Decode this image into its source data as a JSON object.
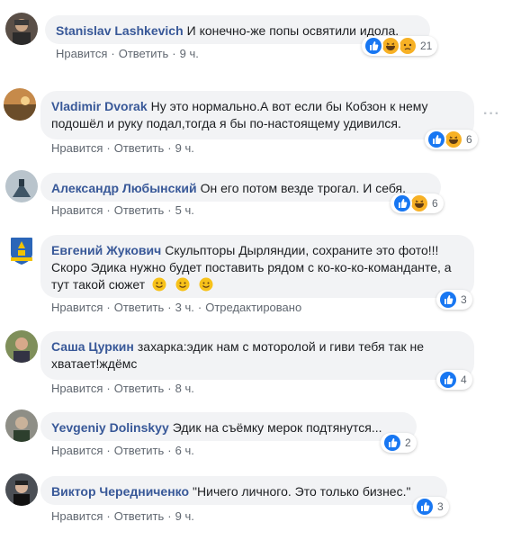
{
  "comments": [
    {
      "author": "Stanislav Lashkevich",
      "text": "И конечно-же попы освятили идола.",
      "like_label": "Нравится",
      "reply_label": "Ответить",
      "time": "9 ч.",
      "reaction_count": "21",
      "reactions": [
        "like-icon",
        "haha-icon",
        "sad-icon"
      ]
    },
    {
      "author": "Vladimir Dvorak",
      "text": "Ну это нормально.А вот если бы Кобзон к нему подошёл и руку подал,тогда я бы по-настоящему удивился.",
      "like_label": "Нравится",
      "reply_label": "Ответить",
      "time": "9 ч.",
      "reaction_count": "6",
      "reactions": [
        "like-icon",
        "haha-icon"
      ],
      "more": "···"
    },
    {
      "author": "Александр Любынский",
      "text": "Он его потом везде трогал. И себя.",
      "like_label": "Нравится",
      "reply_label": "Ответить",
      "time": "5 ч.",
      "reaction_count": "6",
      "reactions": [
        "like-icon",
        "haha-icon"
      ]
    },
    {
      "author": "Евгений Жукович",
      "text": "Скульпторы Дырляндии, сохраните это фото!!! Скоро Эдика нужно будет поставить рядом с ко-ко-ко-командан­те, а тут такой сюжет",
      "like_label": "Нравится",
      "reply_label": "Ответить",
      "time": "3 ч.",
      "edited": "Отредактировано",
      "reaction_count": "3",
      "reactions": [
        "like-icon"
      ]
    },
    {
      "author": "Саша Цуркин",
      "text": "захарка:эдик нам с моторолой и гиви тебя так не хватает!ждёмс",
      "like_label": "Нравится",
      "reply_label": "Ответить",
      "time": "8 ч.",
      "reaction_count": "4",
      "reactions": [
        "like-icon"
      ]
    },
    {
      "author": "Yevgeniy Dolinskyy",
      "text": "Эдик на съёмку мерок подтянутся...",
      "like_label": "Нравится",
      "reply_label": "Ответить",
      "time": "6 ч.",
      "reaction_count": "2",
      "reactions": [
        "like-icon"
      ]
    },
    {
      "author": "Виктор Чередниченко",
      "text": "\"Ничего личного. Это только бизнес.\"",
      "like_label": "Нравится",
      "reply_label": "Ответить",
      "time": "9 ч.",
      "reaction_count": "3",
      "reactions": [
        "like-icon"
      ]
    }
  ],
  "colors": {
    "author": "#385898",
    "bubble": "#f2f3f5",
    "meta": "#606770",
    "like_blue": "#1877f2",
    "haha_yellow": "#f7b125"
  }
}
